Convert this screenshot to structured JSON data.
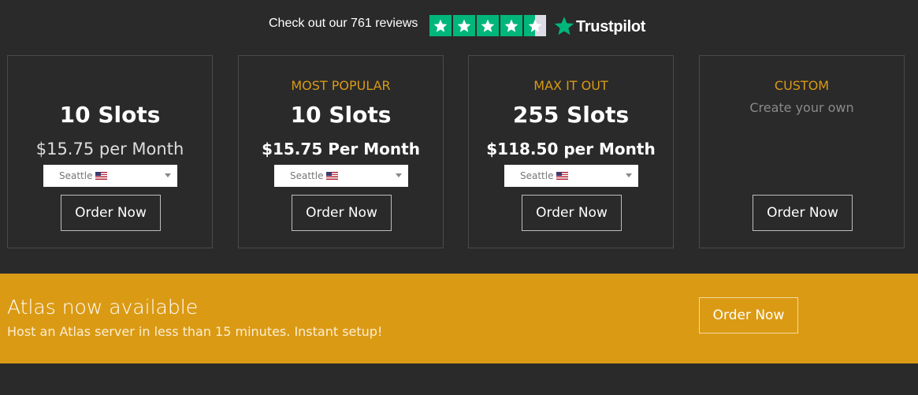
{
  "trustpilot": {
    "reviews_text": "Check out our 761 reviews",
    "rating_stars": 4.5,
    "brand": "Trustpilot",
    "star_color": "#00b67a"
  },
  "plans": [
    {
      "tag": "",
      "title": "10 Slots",
      "price": "$15.75 per Month",
      "location": "Seattle",
      "order_label": "Order Now"
    },
    {
      "tag": "MOST POPULAR",
      "title": "10 Slots",
      "price": "$15.75 Per Month",
      "location": "Seattle",
      "order_label": "Order Now"
    },
    {
      "tag": "MAX IT OUT",
      "title": "255 Slots",
      "price": "$118.50 per Month",
      "location": "Seattle",
      "order_label": "Order Now"
    },
    {
      "tag": "CUSTOM",
      "subtitle": "Create your own",
      "order_label": "Order Now"
    }
  ],
  "atlas": {
    "title": "Atlas now available",
    "subtitle": "Host an Atlas server in less than 15 minutes. Instant setup!",
    "order_label": "Order Now",
    "background": "#db9a14"
  },
  "colors": {
    "accent": "#d99a15",
    "background": "#2a2a2a"
  }
}
